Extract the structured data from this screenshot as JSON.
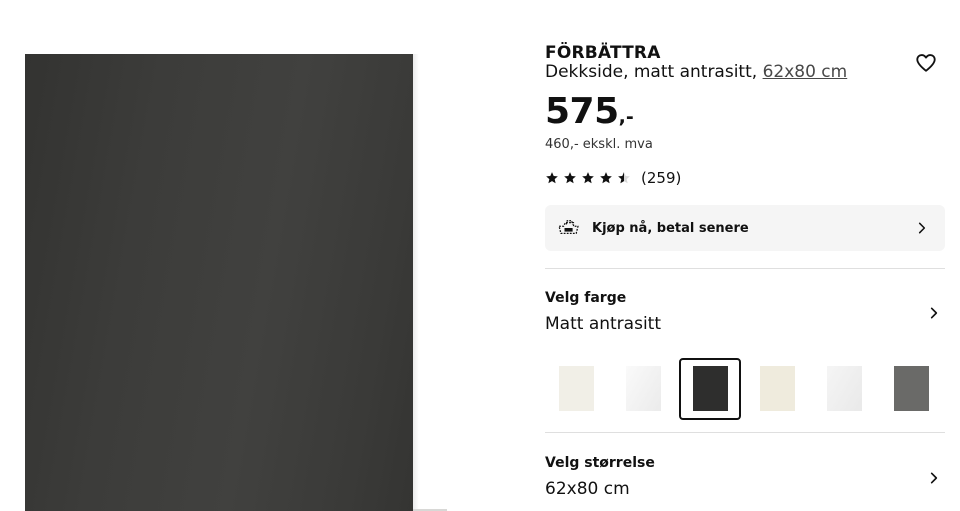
{
  "product": {
    "name": "FÖRBÄTTRA",
    "description": "Dekkside, matt antrasitt,",
    "size_link": "62x80 cm",
    "image_color": "#3c3c3a"
  },
  "price": {
    "integer": "575",
    "decimal": ",-",
    "excl_vat": "460,- ekskl. mva"
  },
  "rating": {
    "stars": 4.5,
    "max_stars": 5,
    "review_count": "(259)"
  },
  "payment": {
    "label": "Kjøp nå, betal senere",
    "icon": "klarna-pay-later-icon"
  },
  "color_section": {
    "label": "Velg farge",
    "value": "Matt antrasitt",
    "swatches": [
      {
        "name": "off-white",
        "color": "#f1efe7",
        "selected": false
      },
      {
        "name": "white-gloss",
        "color": "#f4f4f4",
        "selected": false
      },
      {
        "name": "matt-anthracite",
        "color": "#2e2e2d",
        "selected": true
      },
      {
        "name": "beige",
        "color": "#efebdd",
        "selected": false
      },
      {
        "name": "light-grey-white",
        "color": "#efefef",
        "selected": false
      },
      {
        "name": "grey",
        "color": "#6a6a68",
        "selected": false
      }
    ]
  },
  "size_section": {
    "label": "Velg størrelse",
    "value": "62x80 cm"
  },
  "colors": {
    "text": "#111111",
    "panel_bg": "#f5f5f5",
    "divider": "#dfdfdf"
  }
}
